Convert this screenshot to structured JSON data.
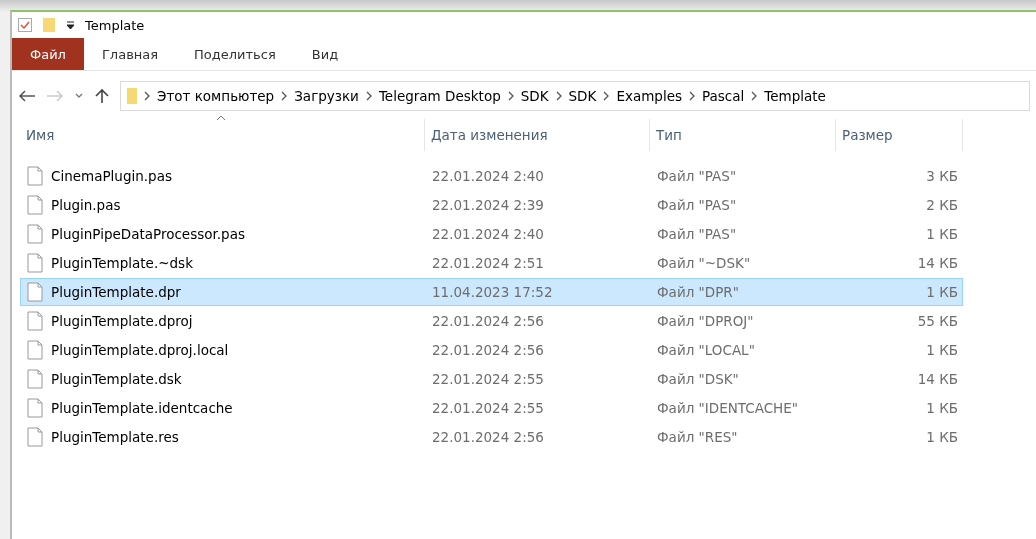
{
  "window": {
    "title": "Template"
  },
  "ribbon_tabs": [
    {
      "label": "Файл",
      "selected": true
    },
    {
      "label": "Главная",
      "selected": false
    },
    {
      "label": "Поделиться",
      "selected": false
    },
    {
      "label": "Вид",
      "selected": false
    }
  ],
  "breadcrumbs": [
    "Этот компьютер",
    "Загрузки",
    "Telegram Desktop",
    "SDK",
    "SDK",
    "Examples",
    "Pascal",
    "Template"
  ],
  "table": {
    "columns": [
      "Имя",
      "Дата изменения",
      "Тип",
      "Размер"
    ],
    "rows": [
      {
        "name": "CinemaPlugin.pas",
        "date": "22.01.2024 2:40",
        "type": "Файл \"PAS\"",
        "size": "3 КБ",
        "selected": false
      },
      {
        "name": "Plugin.pas",
        "date": "22.01.2024 2:39",
        "type": "Файл \"PAS\"",
        "size": "2 КБ",
        "selected": false
      },
      {
        "name": "PluginPipeDataProcessor.pas",
        "date": "22.01.2024 2:40",
        "type": "Файл \"PAS\"",
        "size": "1 КБ",
        "selected": false
      },
      {
        "name": "PluginTemplate.~dsk",
        "date": "22.01.2024 2:51",
        "type": "Файл \"~DSK\"",
        "size": "14 КБ",
        "selected": false
      },
      {
        "name": "PluginTemplate.dpr",
        "date": "11.04.2023 17:52",
        "type": "Файл \"DPR\"",
        "size": "1 КБ",
        "selected": true
      },
      {
        "name": "PluginTemplate.dproj",
        "date": "22.01.2024 2:56",
        "type": "Файл \"DPROJ\"",
        "size": "55 КБ",
        "selected": false
      },
      {
        "name": "PluginTemplate.dproj.local",
        "date": "22.01.2024 2:56",
        "type": "Файл \"LOCAL\"",
        "size": "1 КБ",
        "selected": false
      },
      {
        "name": "PluginTemplate.dsk",
        "date": "22.01.2024 2:55",
        "type": "Файл \"DSK\"",
        "size": "14 КБ",
        "selected": false
      },
      {
        "name": "PluginTemplate.identcache",
        "date": "22.01.2024 2:55",
        "type": "Файл \"IDENTCACHE\"",
        "size": "1 КБ",
        "selected": false
      },
      {
        "name": "PluginTemplate.res",
        "date": "22.01.2024 2:56",
        "type": "Файл \"RES\"",
        "size": "1 КБ",
        "selected": false
      }
    ]
  }
}
